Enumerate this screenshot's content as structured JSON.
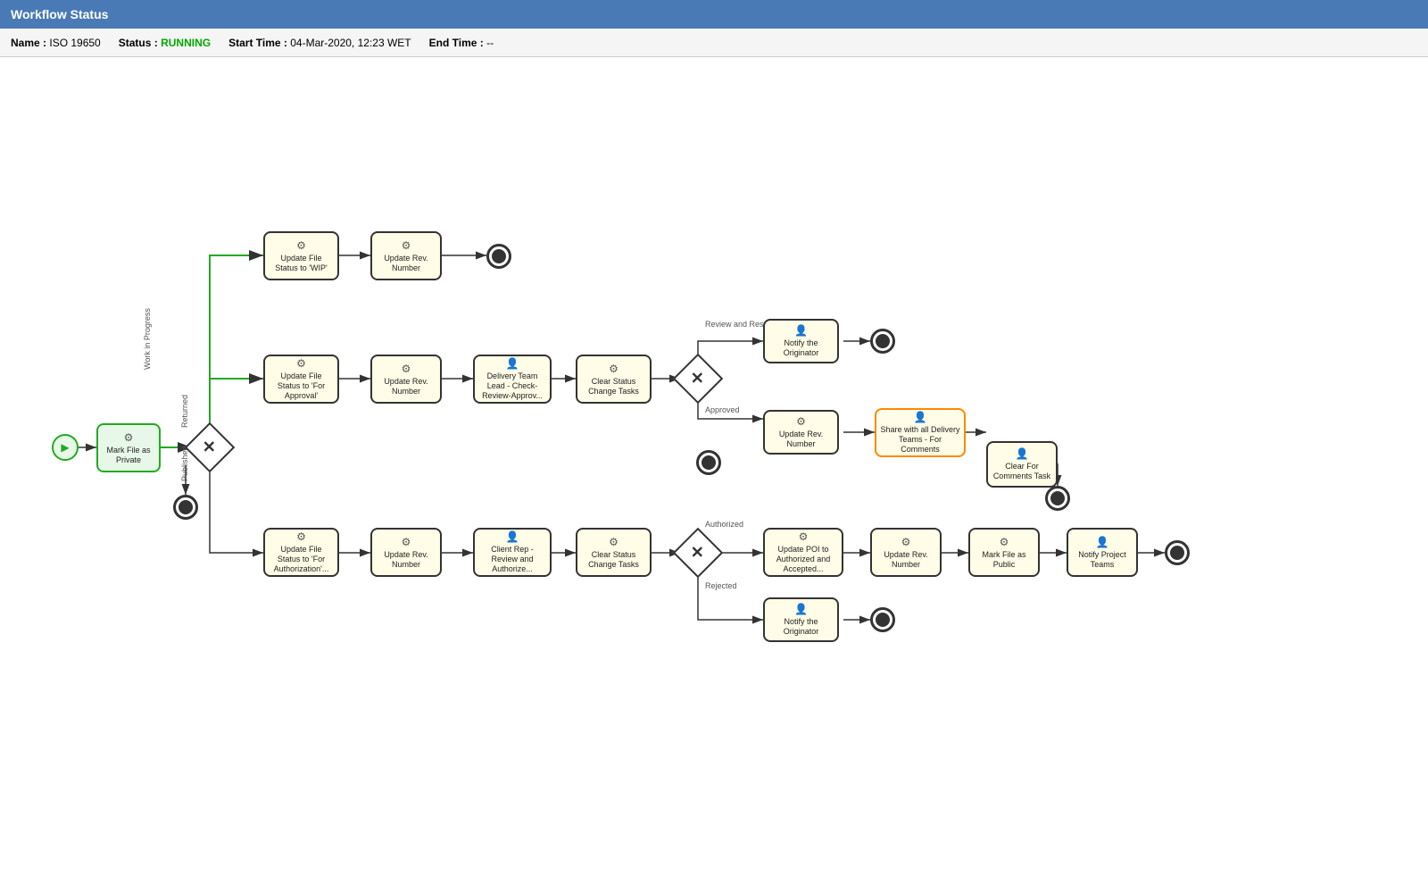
{
  "titleBar": {
    "label": "Workflow Status"
  },
  "statusBar": {
    "nameLabel": "Name :",
    "nameValue": "ISO 19650",
    "statusLabel": "Status :",
    "statusValue": "RUNNING",
    "startTimeLabel": "Start Time :",
    "startTimeValue": "04-Mar-2020, 12:23 WET",
    "endTimeLabel": "End Time :",
    "endTimeValue": "--"
  },
  "nodes": {
    "markFilePrivate": "Mark File as\nPrivate",
    "updateFileStatusWIP": "Update File Status\nto 'WIP'",
    "updateRevNumberTop": "Update Rev.\nNumber",
    "updateFileStatusApproval": "Update File Status\nto 'For Approval'",
    "updateRevNumberMiddle": "Update Rev.\nNumber",
    "deliveryTeamLead": "Delivery Team\nLead - Check-\nReview-Approv...",
    "clearStatusChangeTasks1": "Clear Status\nChange Tasks",
    "notifyOriginator1": "Notify the\nOriginator",
    "updateRevNumber3": "Update Rev.\nNumber",
    "shareDeliveryTeams": "Share with all\nDelivery Teams -\nFor Comments",
    "clearForCommentsTask": "Clear For\nComments Task",
    "updateFileStatusAuth": "Update File Status\nto 'For\nAuthorization'...",
    "updateRevNumber4": "Update Rev.\nNumber",
    "clientRepReview": "Client Rep -\nReview and\nAuthorize...",
    "clearStatusChangeTasks2": "Clear Status\nChange Tasks",
    "updatePOI": "Update POI to\nAuthorized and\nAccepted...",
    "updateRevNumber5": "Update Rev.\nNumber",
    "markFilePublic": "Mark File as\nPublic",
    "notifyProjectTeams": "Notify Project\nTeams",
    "notifyOriginator2": "Notify the\nOriginator"
  },
  "swimlaneLabels": {
    "workInProgress": "Work in Progress",
    "returned": "Returned",
    "published": "Published",
    "reviewAndResubmit": "Review and Resubmit",
    "approved": "Approved",
    "authorized": "Authorized",
    "rejected": "Rejected"
  },
  "colors": {
    "titleBarBg": "#4a7ab5",
    "statusGreen": "#00aa00",
    "nodeDefault": "#fffde7",
    "nodeBorderDefault": "#555555",
    "nodeBorderGreen": "#22aa22",
    "nodeBorderOrange": "#ff8800",
    "gearIcon": "⚙",
    "personIcon": "👤",
    "playIcon": "▶",
    "crossIcon": "✕"
  }
}
